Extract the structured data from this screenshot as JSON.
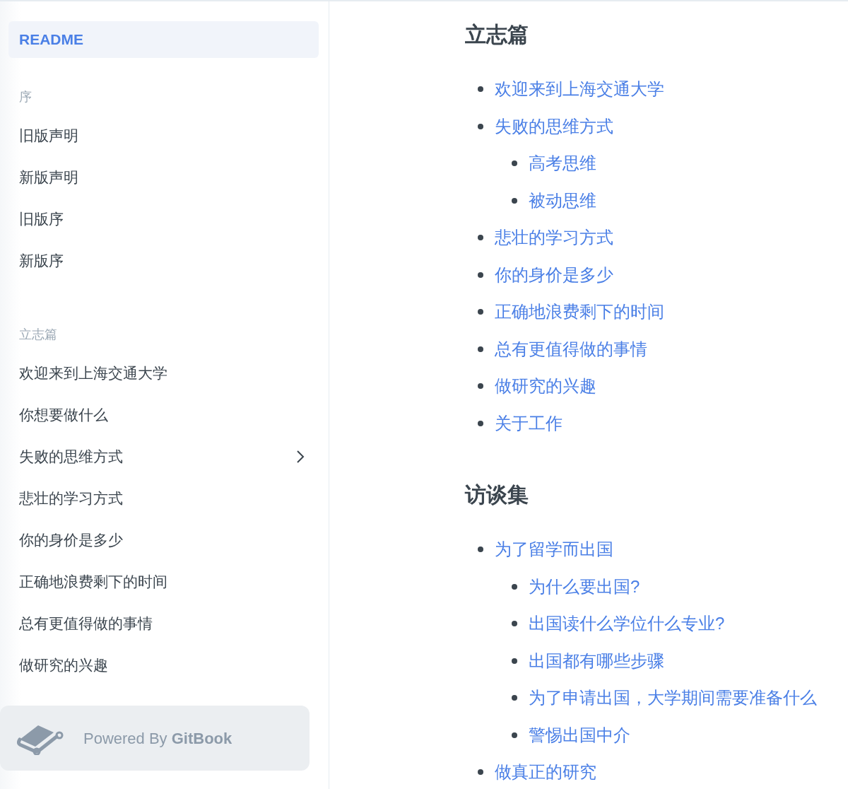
{
  "sidebar": {
    "readme": {
      "label": "README",
      "selected": true
    },
    "sections": [
      {
        "title": "序",
        "items": [
          {
            "label": "旧版声明",
            "expandable": false
          },
          {
            "label": "新版声明",
            "expandable": false
          },
          {
            "label": "旧版序",
            "expandable": false
          },
          {
            "label": "新版序",
            "expandable": false
          }
        ]
      },
      {
        "title": "立志篇",
        "items": [
          {
            "label": "欢迎来到上海交通大学",
            "expandable": false
          },
          {
            "label": "你想要做什么",
            "expandable": false
          },
          {
            "label": "失败的思维方式",
            "expandable": true
          },
          {
            "label": "悲壮的学习方式",
            "expandable": false
          },
          {
            "label": "你的身价是多少",
            "expandable": false
          },
          {
            "label": "正确地浪费剩下的时间",
            "expandable": false
          },
          {
            "label": "总有更值得做的事情",
            "expandable": false
          },
          {
            "label": "做研究的兴趣",
            "expandable": false
          }
        ]
      }
    ],
    "footer": "Powered By **GitBook**"
  },
  "content": [
    {
      "heading": "立志篇",
      "items": [
        {
          "label": "欢迎来到上海交通大学"
        },
        {
          "label": "失败的思维方式",
          "children": [
            {
              "label": "高考思维"
            },
            {
              "label": "被动思维"
            }
          ]
        },
        {
          "label": "悲壮的学习方式"
        },
        {
          "label": "你的身价是多少"
        },
        {
          "label": "正确地浪费剩下的时间"
        },
        {
          "label": "总有更值得做的事情"
        },
        {
          "label": "做研究的兴趣"
        },
        {
          "label": "关于工作"
        }
      ]
    },
    {
      "heading": "访谈集",
      "items": [
        {
          "label": "为了留学而出国",
          "children": [
            {
              "label": "为什么要出国?"
            },
            {
              "label": "出国读什么学位什么专业?"
            },
            {
              "label": "出国都有哪些步骤"
            },
            {
              "label": "为了申请出国，大学期间需要准备什么"
            },
            {
              "label": "警惕出国中介"
            }
          ]
        },
        {
          "label": "做真正的研究"
        }
      ]
    }
  ]
}
